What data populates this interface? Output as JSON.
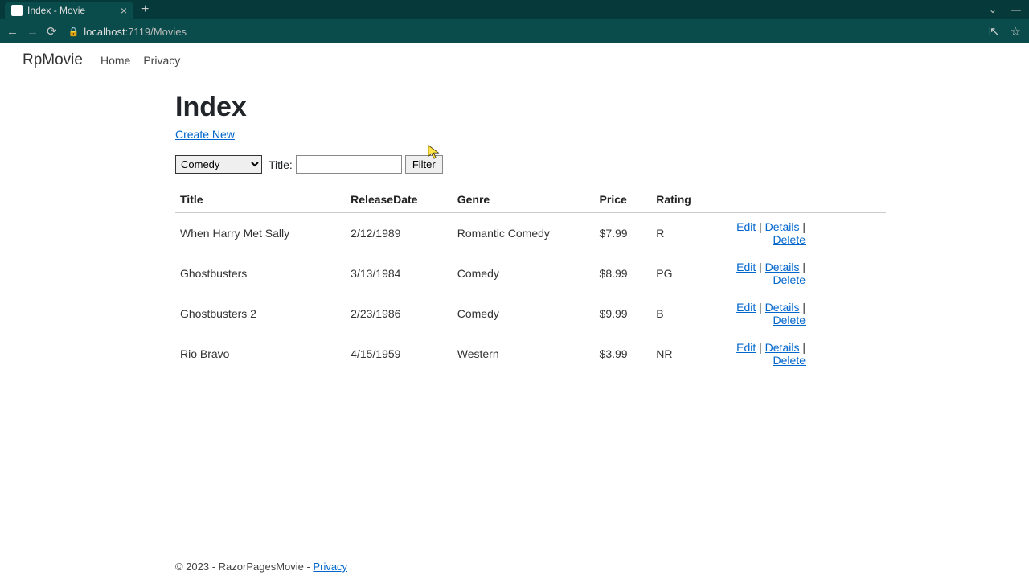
{
  "browser": {
    "tab_title": "Index - Movie",
    "url_host": "localhost",
    "url_port": ":7119",
    "url_path": "/Movies"
  },
  "nav": {
    "brand": "RpMovie",
    "links": [
      "Home",
      "Privacy"
    ]
  },
  "page": {
    "heading": "Index",
    "create_label": "Create New",
    "title_label": "Title:",
    "filter_button": "Filter",
    "genre_selected": "Comedy"
  },
  "table": {
    "headers": [
      "Title",
      "ReleaseDate",
      "Genre",
      "Price",
      "Rating",
      ""
    ],
    "rows": [
      {
        "title": "When Harry Met Sally",
        "releaseDate": "2/12/1989",
        "genre": "Romantic Comedy",
        "price": "$7.99",
        "rating": "R"
      },
      {
        "title": "Ghostbusters",
        "releaseDate": "3/13/1984",
        "genre": "Comedy",
        "price": "$8.99",
        "rating": "PG"
      },
      {
        "title": "Ghostbusters 2",
        "releaseDate": "2/23/1986",
        "genre": "Comedy",
        "price": "$9.99",
        "rating": "B"
      },
      {
        "title": "Rio Bravo",
        "releaseDate": "4/15/1959",
        "genre": "Western",
        "price": "$3.99",
        "rating": "NR"
      }
    ],
    "actions": {
      "edit": "Edit",
      "details": "Details",
      "delete": "Delete"
    }
  },
  "footer": {
    "text": "© 2023 - RazorPagesMovie - ",
    "privacy": "Privacy"
  }
}
